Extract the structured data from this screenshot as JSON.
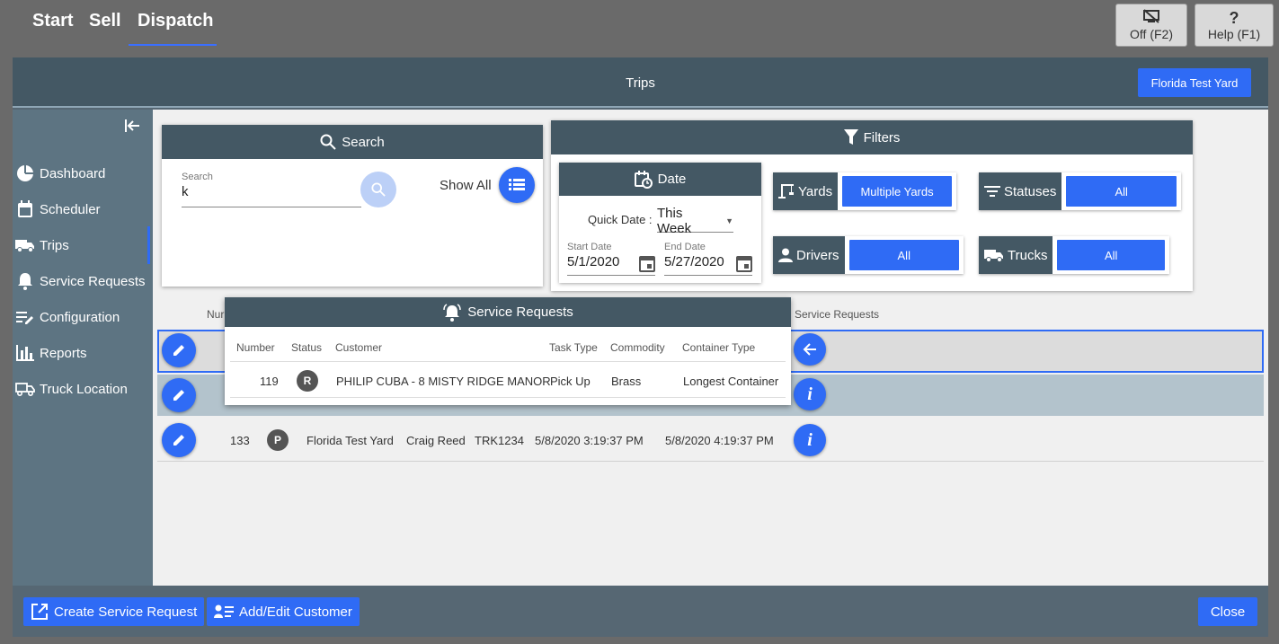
{
  "nav": {
    "tabs": [
      "Start",
      "Sell",
      "Dispatch"
    ],
    "active": "Dispatch"
  },
  "top_buttons": {
    "off": "Off (F2)",
    "help_icon": "?",
    "help": "Help (F1)"
  },
  "window": {
    "title": "Trips",
    "yard_button": "Florida Test Yard"
  },
  "sidebar": {
    "items": [
      {
        "label": "Dashboard",
        "icon": "pie-chart-icon"
      },
      {
        "label": "Scheduler",
        "icon": "calendar-icon"
      },
      {
        "label": "Trips",
        "icon": "truck-icon"
      },
      {
        "label": "Service Requests",
        "icon": "bell-icon"
      },
      {
        "label": "Configuration",
        "icon": "edit-list-icon"
      },
      {
        "label": "Reports",
        "icon": "bar-chart-icon"
      },
      {
        "label": "Truck Location",
        "icon": "truck-location-icon"
      }
    ],
    "active": "Trips"
  },
  "search": {
    "title": "Search",
    "field_label": "Search",
    "field_value": "k",
    "show_all": "Show All"
  },
  "filters": {
    "title": "Filters",
    "date": {
      "title": "Date",
      "quick_label": "Quick Date :",
      "quick_value": "This Week",
      "start_label": "Start Date",
      "start_value": "5/1/2020",
      "end_label": "End Date",
      "end_value": "5/27/2020"
    },
    "yards": {
      "label": "Yards",
      "value": "Multiple Yards"
    },
    "statuses": {
      "label": "Statuses",
      "value": "All"
    },
    "drivers": {
      "label": "Drivers",
      "value": "All"
    },
    "trucks": {
      "label": "Trucks",
      "value": "All"
    }
  },
  "table": {
    "header_partial": "Nur",
    "service_requests_header": "Service Requests",
    "rows": [
      {
        "number": "133",
        "status": "P",
        "yard": "Florida Test Yard",
        "driver": "Craig Reed",
        "truck": "TRK1234",
        "start": "5/8/2020 3:19:37 PM",
        "end": "5/8/2020 4:19:37 PM"
      }
    ]
  },
  "popup": {
    "title": "Service Requests",
    "headers": [
      "Number",
      "Status",
      "Customer",
      "Task Type",
      "Commodity",
      "Container Type"
    ],
    "rows": [
      {
        "number": "119",
        "status": "R",
        "customer": "PHILIP CUBA - 8 MISTY RIDGE MANOR",
        "task_type": "Pick Up",
        "commodity": "Brass",
        "container_type": "Longest Container"
      }
    ]
  },
  "footer": {
    "create": "Create Service Request",
    "add_edit": "Add/Edit Customer",
    "close": "Close"
  },
  "colors": {
    "accent": "#2f6bf5",
    "header": "#445864",
    "sidebar": "#5d7482"
  }
}
